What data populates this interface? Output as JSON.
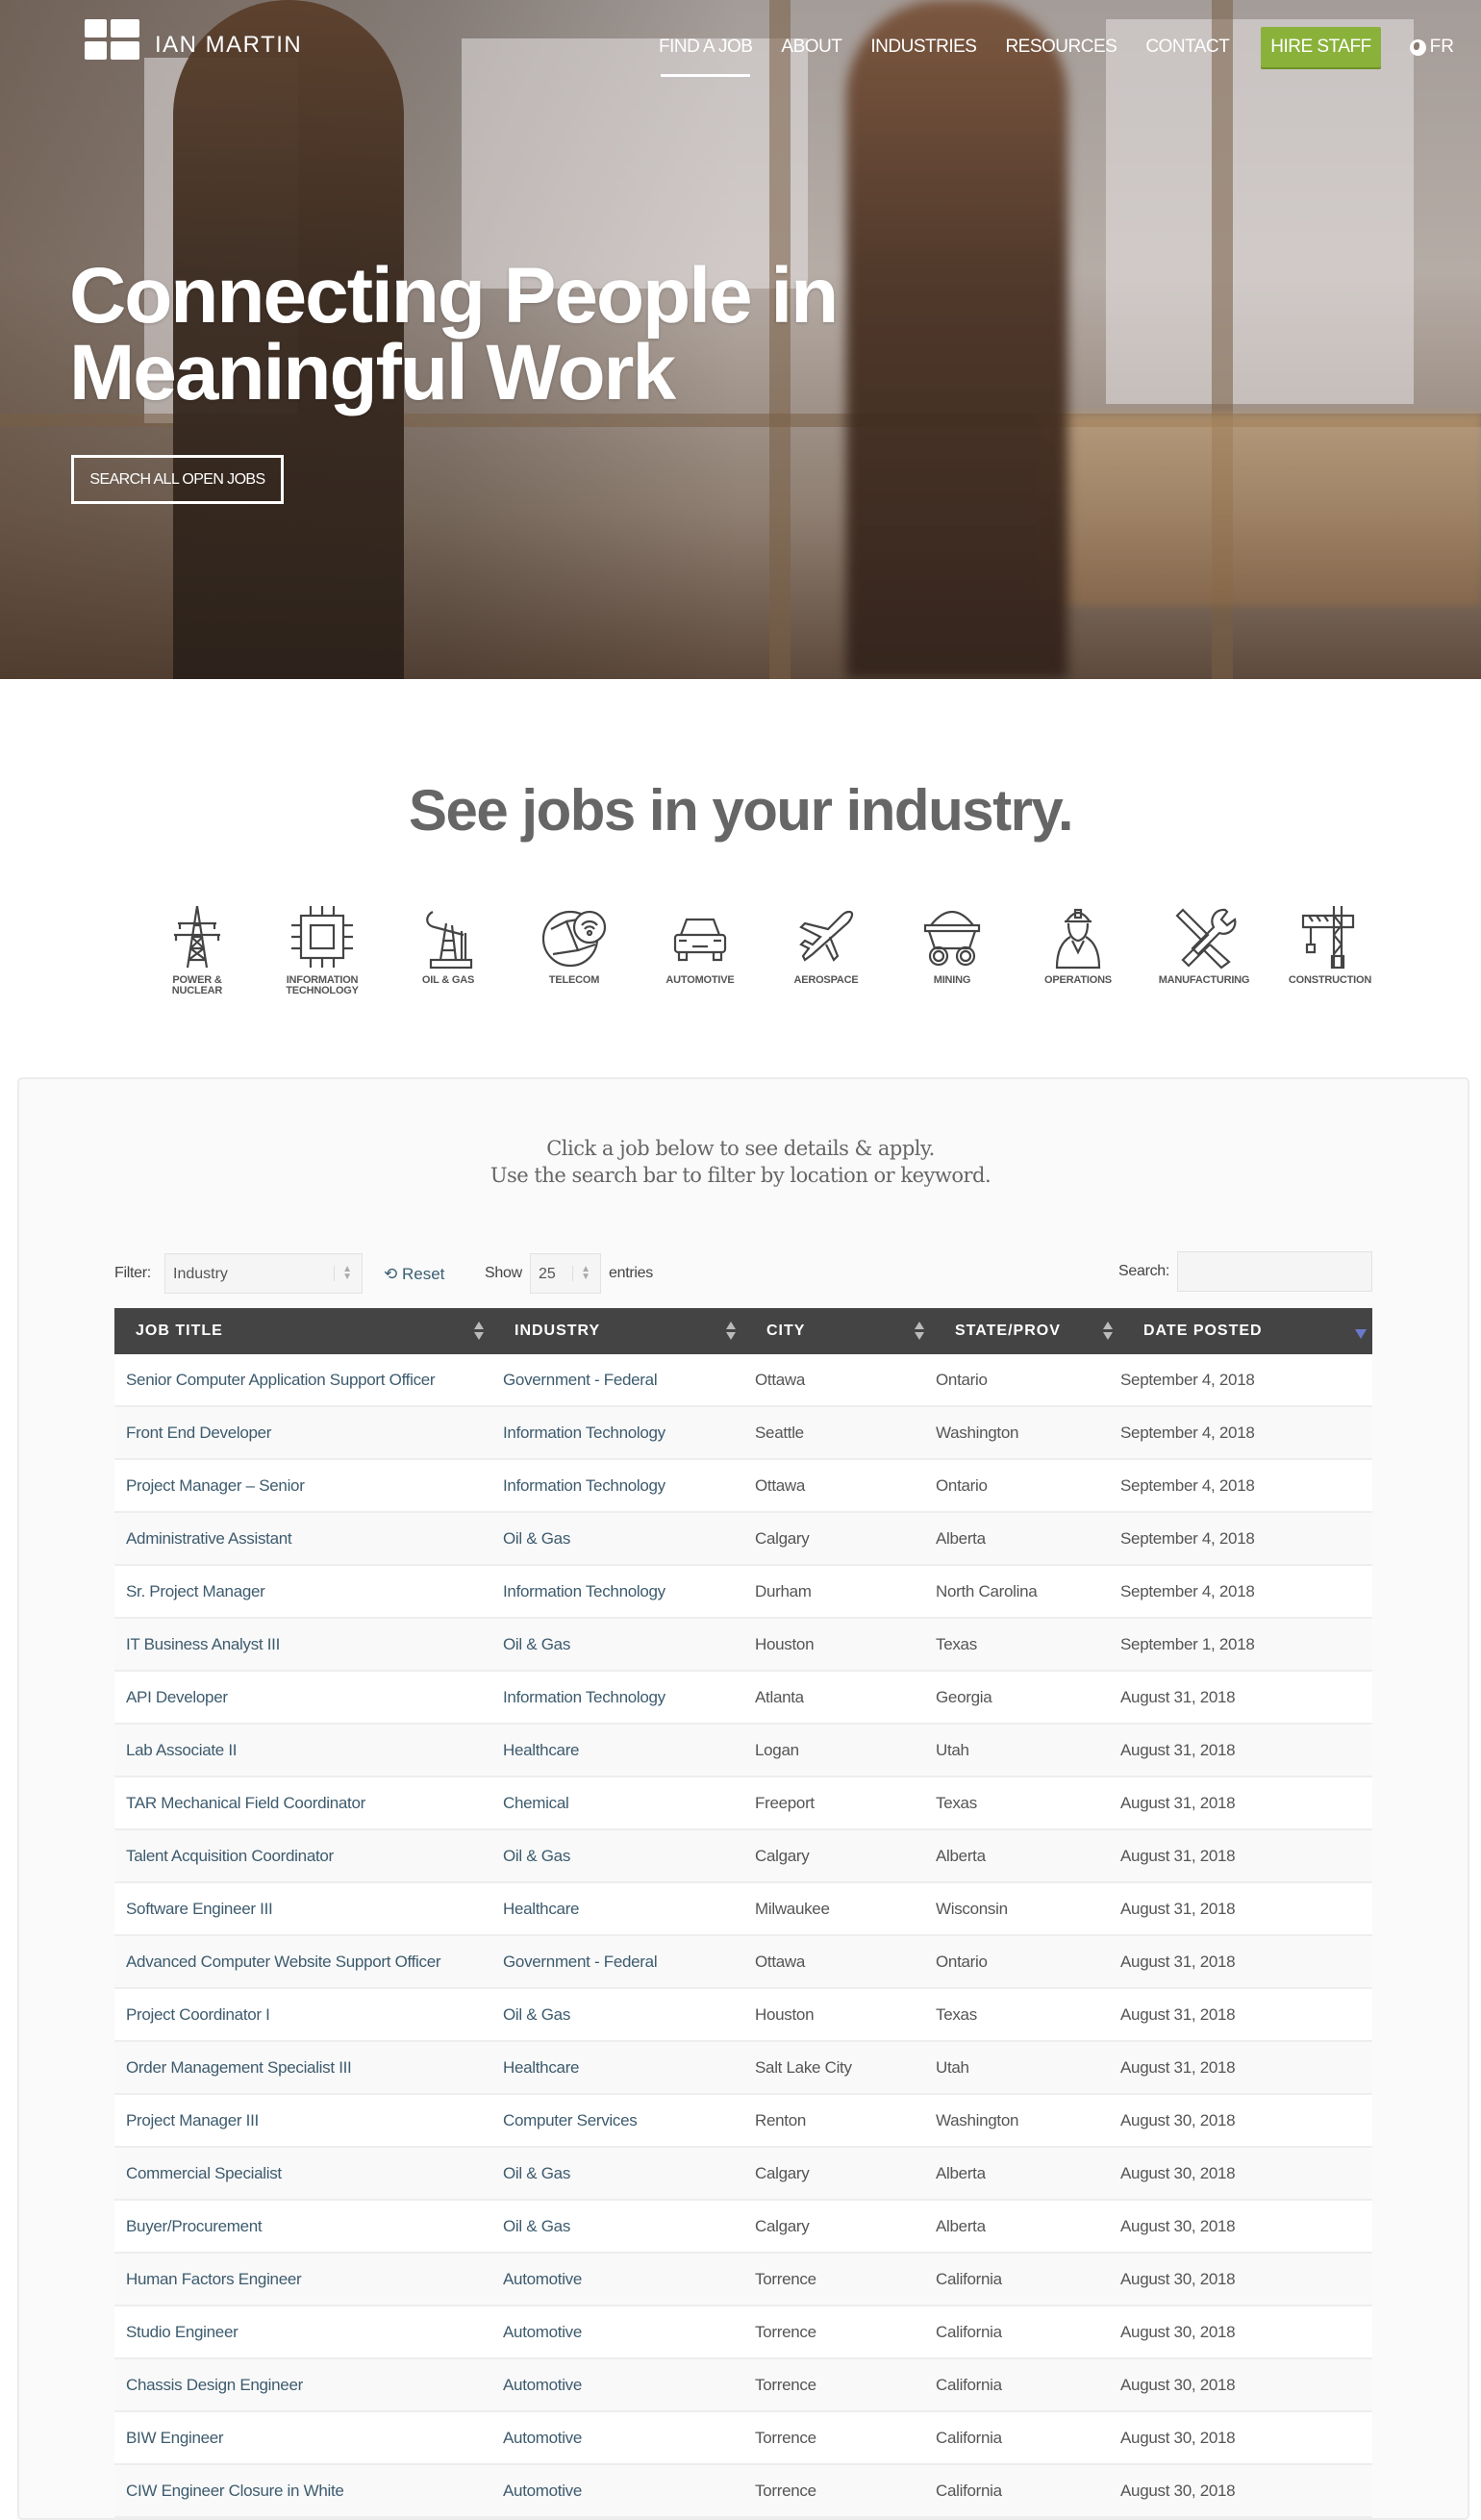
{
  "brand": {
    "name": "IAN MARTIN"
  },
  "nav": {
    "items": [
      {
        "label": "FIND A JOB",
        "active": true
      },
      {
        "label": "ABOUT"
      },
      {
        "label": "INDUSTRIES"
      },
      {
        "label": "RESOURCES"
      },
      {
        "label": "CONTACT"
      }
    ],
    "hire_label": "HIRE STAFF",
    "lang_label": "FR",
    "colors": {
      "hire_bg": "#8ab23a"
    }
  },
  "hero": {
    "title_line1": "Connecting People in",
    "title_line2": "Meaningful Work",
    "cta_label": "SEARCH ALL OPEN JOBS"
  },
  "industries": {
    "title": "See jobs in your industry.",
    "items": [
      {
        "label": "POWER &\nNUCLEAR",
        "icon": "power-tower-icon"
      },
      {
        "label": "INFORMATION\nTECHNOLOGY",
        "icon": "chip-icon"
      },
      {
        "label": "OIL & GAS",
        "icon": "oil-pump-icon"
      },
      {
        "label": "TELECOM",
        "icon": "globe-wifi-icon"
      },
      {
        "label": "AUTOMOTIVE",
        "icon": "car-icon"
      },
      {
        "label": "AEROSPACE",
        "icon": "airplane-icon"
      },
      {
        "label": "MINING",
        "icon": "mine-cart-icon"
      },
      {
        "label": "OPERATIONS",
        "icon": "worker-icon"
      },
      {
        "label": "MANUFACTURING",
        "icon": "tools-icon"
      },
      {
        "label": "CONSTRUCTION",
        "icon": "crane-icon"
      }
    ]
  },
  "jobs": {
    "intro_line1": "Click a job below to see details & apply.",
    "intro_line2": "Use the search bar to filter by location or keyword.",
    "filter_label": "Filter:",
    "filter_value": "Industry",
    "reset_label": "Reset",
    "show_label": "Show",
    "entries_value": "25",
    "entries_label": "entries",
    "search_label": "Search:",
    "search_value": "",
    "columns": [
      "JOB TITLE",
      "INDUSTRY",
      "CITY",
      "STATE/PROV",
      "DATE POSTED"
    ],
    "rows": [
      [
        "Senior Computer Application Support Officer",
        "Government - Federal",
        "Ottawa",
        "Ontario",
        "September 4, 2018"
      ],
      [
        "Front End Developer",
        "Information Technology",
        "Seattle",
        "Washington",
        "September 4, 2018"
      ],
      [
        "Project Manager – Senior",
        "Information Technology",
        "Ottawa",
        "Ontario",
        "September 4, 2018"
      ],
      [
        "Administrative Assistant",
        "Oil & Gas",
        "Calgary",
        "Alberta",
        "September 4, 2018"
      ],
      [
        "Sr. Project Manager",
        "Information Technology",
        "Durham",
        "North Carolina",
        "September 4, 2018"
      ],
      [
        "IT Business Analyst III",
        "Oil & Gas",
        "Houston",
        "Texas",
        "September 1, 2018"
      ],
      [
        "API Developer",
        "Information Technology",
        "Atlanta",
        "Georgia",
        "August 31, 2018"
      ],
      [
        "Lab Associate II",
        "Healthcare",
        "Logan",
        "Utah",
        "August 31, 2018"
      ],
      [
        "TAR Mechanical Field Coordinator",
        "Chemical",
        "Freeport",
        "Texas",
        "August 31, 2018"
      ],
      [
        "Talent Acquisition Coordinator",
        "Oil & Gas",
        "Calgary",
        "Alberta",
        "August 31, 2018"
      ],
      [
        "Software Engineer III",
        "Healthcare",
        "Milwaukee",
        "Wisconsin",
        "August 31, 2018"
      ],
      [
        "Advanced Computer Website Support Officer",
        "Government - Federal",
        "Ottawa",
        "Ontario",
        "August 31, 2018"
      ],
      [
        "Project Coordinator I",
        "Oil & Gas",
        "Houston",
        "Texas",
        "August 31, 2018"
      ],
      [
        "Order Management Specialist III",
        "Healthcare",
        "Salt Lake City",
        "Utah",
        "August 31, 2018"
      ],
      [
        "Project Manager III",
        "Computer Services",
        "Renton",
        "Washington",
        "August 30, 2018"
      ],
      [
        "Commercial Specialist",
        "Oil & Gas",
        "Calgary",
        "Alberta",
        "August 30, 2018"
      ],
      [
        "Buyer/Procurement",
        "Oil & Gas",
        "Calgary",
        "Alberta",
        "August 30, 2018"
      ],
      [
        "Human Factors Engineer",
        "Automotive",
        "Torrence",
        "California",
        "August 30, 2018"
      ],
      [
        "Studio Engineer",
        "Automotive",
        "Torrence",
        "California",
        "August 30, 2018"
      ],
      [
        "Chassis Design Engineer",
        "Automotive",
        "Torrence",
        "California",
        "August 30, 2018"
      ],
      [
        "BIW Engineer",
        "Automotive",
        "Torrence",
        "California",
        "August 30, 2018"
      ],
      [
        "CIW Engineer Closure in White",
        "Automotive",
        "Torrence",
        "California",
        "August 30, 2018"
      ]
    ],
    "sorted_column": "DATE POSTED",
    "sort_direction": "descending",
    "colors": {
      "header_bg": "#444444",
      "link": "#3d5b6e",
      "sort_active": "#6a78cc"
    }
  }
}
